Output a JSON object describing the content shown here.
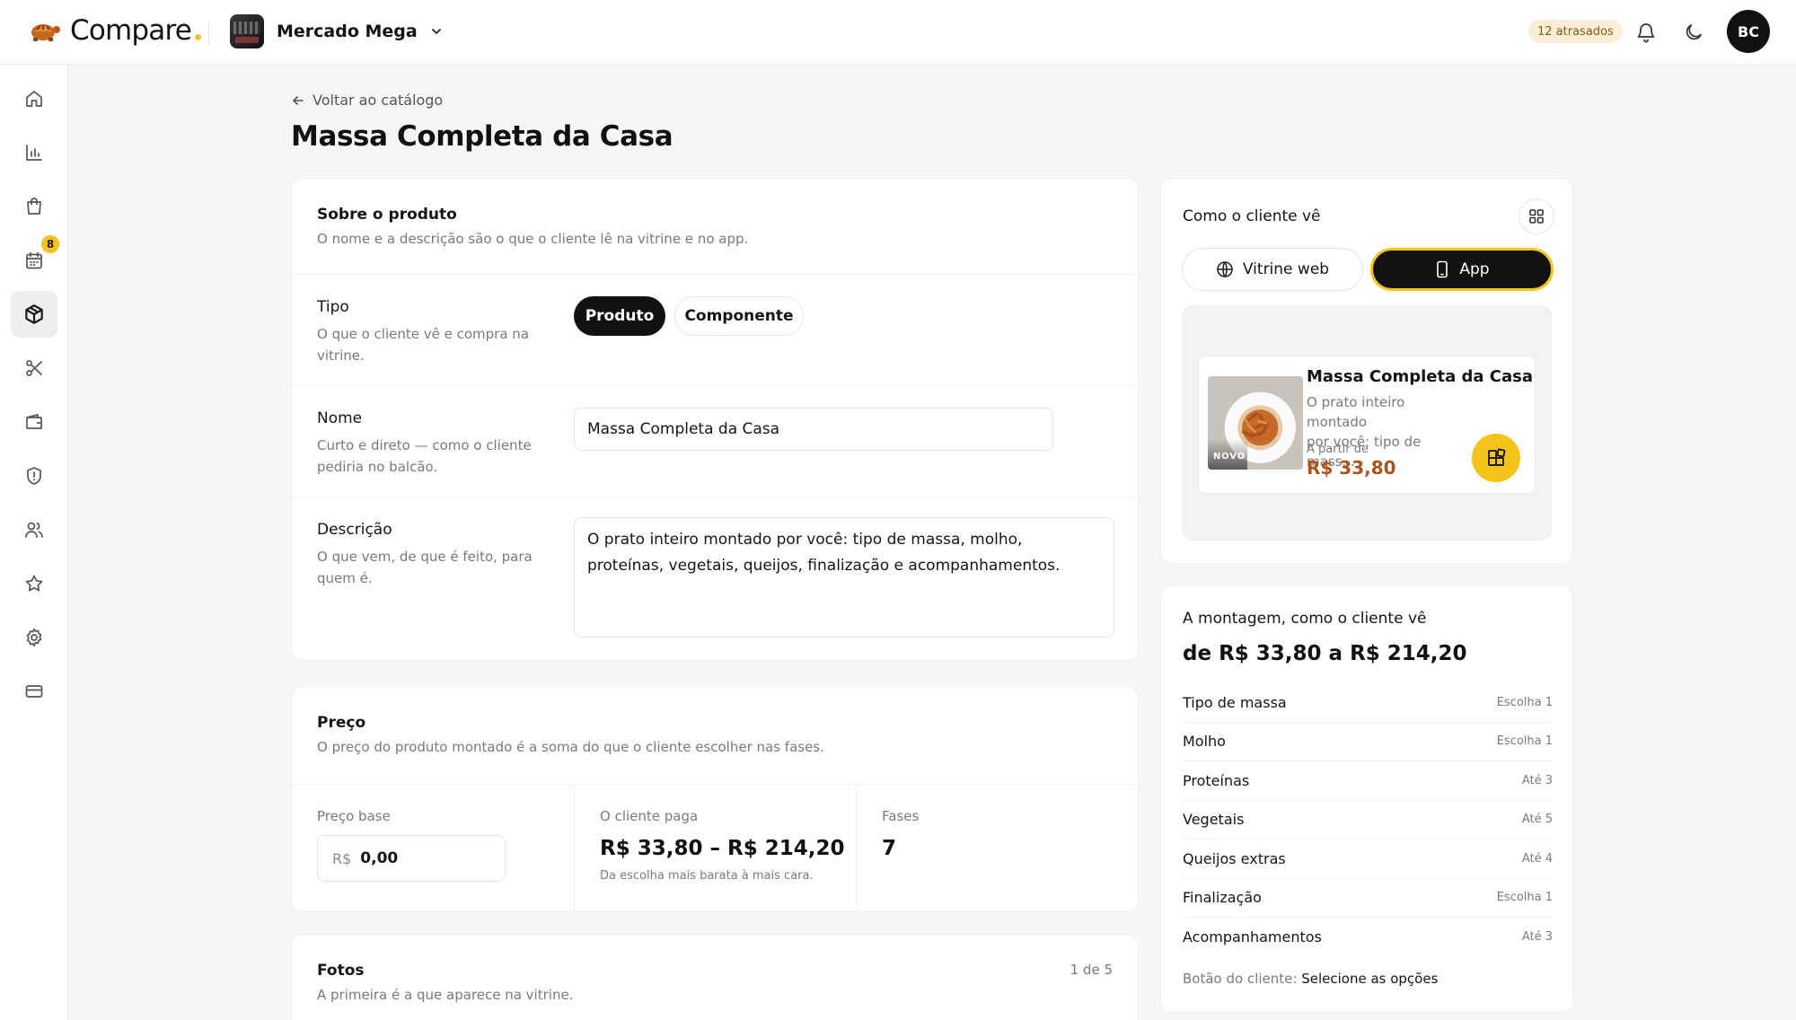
{
  "header": {
    "brand": "Compare",
    "store_name": "Mercado Mega",
    "late_badge": "12 atrasados",
    "avatar_initials": "BC"
  },
  "sidebar": {
    "items": [
      {
        "name": "home",
        "icon": "home-icon"
      },
      {
        "name": "reports",
        "icon": "bar-chart-icon"
      },
      {
        "name": "orders",
        "icon": "shopping-bag-icon"
      },
      {
        "name": "calendar",
        "icon": "calendar-icon",
        "badge": "8"
      },
      {
        "name": "catalog",
        "icon": "box-icon",
        "active": true
      },
      {
        "name": "tools",
        "icon": "scissors-icon"
      },
      {
        "name": "wallet",
        "icon": "wallet-icon"
      },
      {
        "name": "security",
        "icon": "shield-alert-icon"
      },
      {
        "name": "customers",
        "icon": "users-icon"
      },
      {
        "name": "reviews",
        "icon": "star-icon"
      },
      {
        "name": "settings",
        "icon": "gear-icon"
      },
      {
        "name": "billing",
        "icon": "credit-card-icon"
      }
    ]
  },
  "page": {
    "back_label": "Voltar ao catálogo",
    "title": "Massa Completa da Casa"
  },
  "about": {
    "title": "Sobre o produto",
    "subtitle": "O nome e a descrição são o que o cliente lê na vitrine e no app.",
    "type": {
      "label": "Tipo",
      "hint": "O que o cliente vê e compra na vitrine.",
      "options": [
        "Produto",
        "Componente"
      ],
      "selected": "Produto"
    },
    "name": {
      "label": "Nome",
      "hint": "Curto e direto — como o cliente pediria no balcão.",
      "value": "Massa Completa da Casa"
    },
    "description": {
      "label": "Descrição",
      "hint": "O que vem, de que é feito, para quem é.",
      "value": "O prato inteiro montado por você: tipo de massa, molho, proteínas, vegetais, queijos, finalização e acompanhamentos."
    }
  },
  "price": {
    "title": "Preço",
    "subtitle": "O preço do produto montado é a soma do que o cliente escolher nas fases.",
    "base_label": "Preço base",
    "currency": "R$",
    "base_value": "0,00",
    "client_pays_label": "O cliente paga",
    "client_pays_value": "R$ 33,80 – R$ 214,20",
    "client_pays_note": "Da escolha mais barata à mais cara.",
    "phases_label": "Fases",
    "phases_value": "7"
  },
  "photos": {
    "title": "Fotos",
    "subtitle": "A primeira é a que aparece na vitrine.",
    "count": "1 de 5"
  },
  "preview": {
    "title": "Como o cliente vê",
    "tabs": [
      "Vitrine web",
      "App"
    ],
    "selected_tab": "App",
    "card": {
      "badge": "NOVO",
      "name": "Massa Completa da Casa",
      "desc_line1": "O prato inteiro montado",
      "desc_line2": "por você: tipo de mass...",
      "from_label": "A partir de",
      "price": "R$ 33,80"
    }
  },
  "assembly": {
    "title": "A montagem, como o cliente vê",
    "range": "de R$ 33,80 a R$ 214,20",
    "steps": [
      {
        "name": "Tipo de massa",
        "rule": "Escolha 1"
      },
      {
        "name": "Molho",
        "rule": "Escolha 1"
      },
      {
        "name": "Proteínas",
        "rule": "Até 3"
      },
      {
        "name": "Vegetais",
        "rule": "Até 5"
      },
      {
        "name": "Queijos extras",
        "rule": "Até 4"
      },
      {
        "name": "Finalização",
        "rule": "Escolha 1"
      },
      {
        "name": "Acompanhamentos",
        "rule": "Até 3"
      }
    ],
    "button_prefix": "Botão do cliente:",
    "button_label": "Selecione as opções"
  },
  "colors": {
    "accent": "#f5c31a",
    "dark": "#111111",
    "price": "#a9541e"
  }
}
